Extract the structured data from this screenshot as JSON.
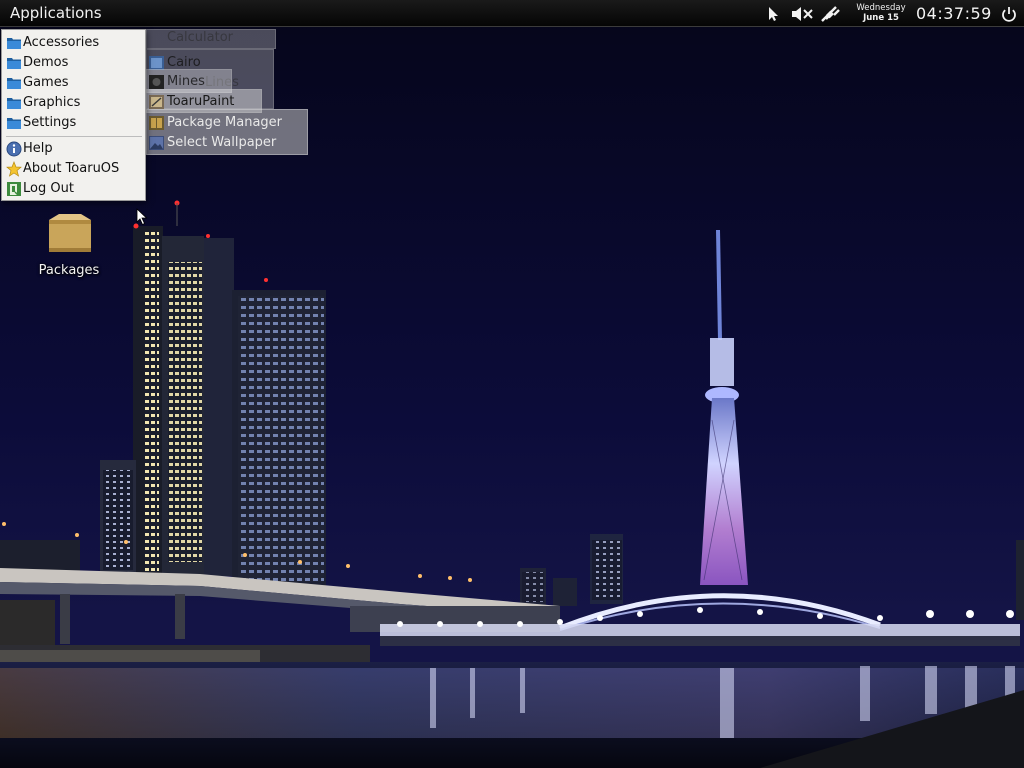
{
  "panel": {
    "apps_label": "Applications",
    "date_day": "Wednesday",
    "date_date": "June 15",
    "clock": "04:37:59",
    "tray_icons": [
      "pointer-icon",
      "volume-muted-icon",
      "network-disconnected-icon",
      "power-icon"
    ]
  },
  "main_menu": {
    "items": [
      {
        "label": "Accessories",
        "icon": "folder-icon"
      },
      {
        "label": "Demos",
        "icon": "folder-icon"
      },
      {
        "label": "Games",
        "icon": "folder-icon"
      },
      {
        "label": "Graphics",
        "icon": "folder-icon"
      },
      {
        "label": "Settings",
        "icon": "folder-icon"
      }
    ],
    "actions": [
      {
        "label": "Help",
        "icon": "help-icon"
      },
      {
        "label": "About ToaruOS",
        "icon": "star-icon"
      },
      {
        "label": "Log Out",
        "icon": "exit-icon"
      }
    ]
  },
  "submenus": {
    "accessories": [
      {
        "label": "Calculator"
      }
    ],
    "demos": [
      {
        "label": "Cairo"
      },
      {
        "label": "Lines"
      }
    ],
    "games": [
      {
        "label": "Mines"
      }
    ],
    "graphics": [
      {
        "label": "ToaruPaint"
      }
    ],
    "settings": [
      {
        "label": "Package Manager",
        "icon": "package-manager-icon"
      },
      {
        "label": "Select Wallpaper",
        "icon": "wallpaper-icon"
      }
    ]
  },
  "desktop": {
    "icons": [
      {
        "label": "Packages",
        "icon": "package-box-icon"
      }
    ]
  },
  "colors": {
    "panel_bg": "#0a0a0a",
    "menu_bg": "#f2f1ee",
    "folder_blue": "#2f7fd0",
    "night_sky": "#0b0b2a"
  }
}
